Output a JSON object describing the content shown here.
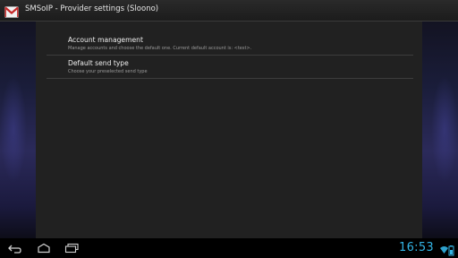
{
  "action_bar": {
    "title": "SMSoIP - Provider settings (Sloono)",
    "icon": "mail-envelope-icon"
  },
  "preferences": [
    {
      "title": "Account management",
      "summary": "Manage accounts and choose the default one. Current default account is: <test>."
    },
    {
      "title": "Default send type",
      "summary": "Choose your preselected send type"
    }
  ],
  "system_bar": {
    "clock": "16:53",
    "nav_icons": [
      "back-icon",
      "home-icon",
      "recent-apps-icon"
    ],
    "status_icons": [
      "wifi-icon",
      "battery-icon"
    ]
  },
  "colors": {
    "accent": "#33b5e5",
    "panel": "#212121",
    "action_bar": "#222222",
    "icon_red": "#c62828"
  }
}
